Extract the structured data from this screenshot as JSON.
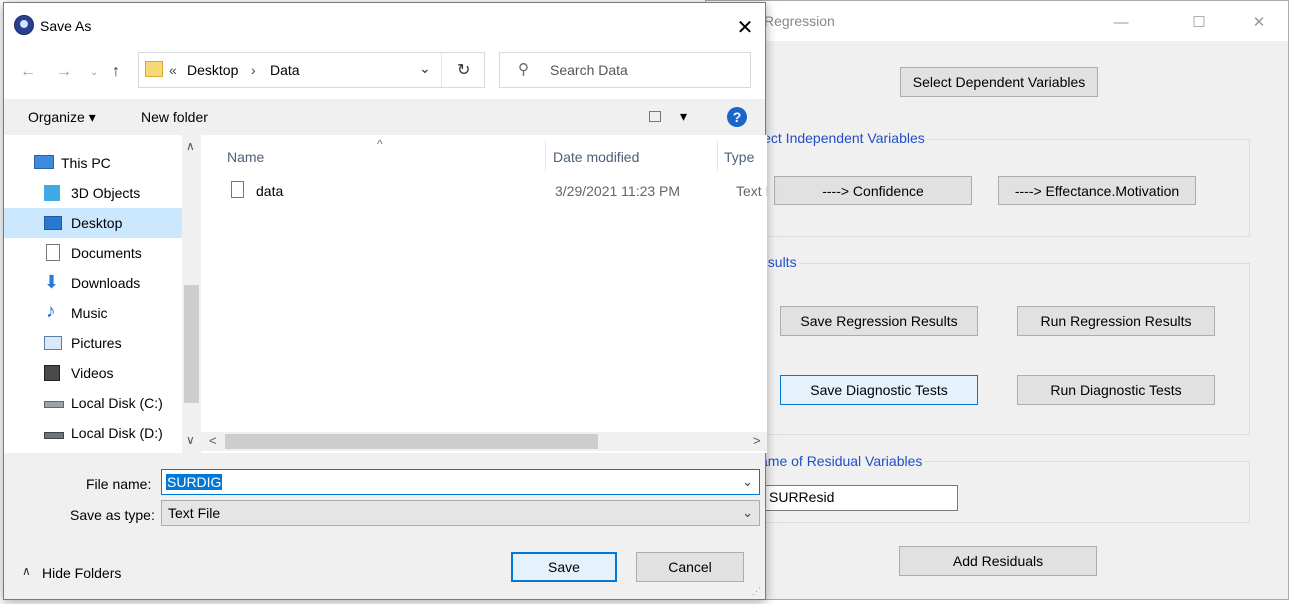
{
  "app_window": {
    "title": "R Regression",
    "title_visible": "Regression",
    "buttons": {
      "select_dependent": "Select Dependent Variables",
      "confidence": "----> Confidence",
      "effectance": "----> Effectance.Motivation",
      "save_regression": "Save Regression Results",
      "run_regression": "Run Regression Results",
      "save_diagnostic": "Save Diagnostic Tests",
      "run_diagnostic": "Run Diagnostic Tests",
      "add_residuals": "Add Residuals"
    },
    "groups": {
      "independent": "lect Independent Variables",
      "results": "esults",
      "residual_name": "ame of Residual Variables"
    },
    "residual_value": "SURResid",
    "caption": {
      "minimize": "—",
      "maximize": "☐",
      "close": "✕"
    }
  },
  "dialog": {
    "title": "Save As",
    "close": "✕",
    "breadcrumb": {
      "prefix": "«",
      "items": [
        "Desktop",
        "Data"
      ],
      "sep": "›"
    },
    "search_placeholder": "Search Data",
    "toolbar": {
      "organize": "Organize ▾",
      "new_folder": "New folder",
      "view": "▾",
      "help": "?"
    },
    "nav_items": [
      {
        "label": "This PC"
      },
      {
        "label": "3D Objects"
      },
      {
        "label": "Desktop"
      },
      {
        "label": "Documents"
      },
      {
        "label": "Downloads"
      },
      {
        "label": "Music"
      },
      {
        "label": "Pictures"
      },
      {
        "label": "Videos"
      },
      {
        "label": "Local Disk (C:)"
      },
      {
        "label": "Local Disk (D:)"
      }
    ],
    "columns": {
      "name": "Name",
      "date": "Date modified",
      "type": "Type"
    },
    "files": [
      {
        "name": "data",
        "date": "3/29/2021 11:23 PM",
        "type": "Text D"
      }
    ],
    "file_name_label": "File name:",
    "file_name_value": "SURDIG",
    "save_type_label": "Save as type:",
    "save_type_value": "Text File",
    "hide_folders": "Hide Folders",
    "save_button": "Save",
    "cancel_button": "Cancel"
  },
  "colors": {
    "accent": "#0078d7",
    "selection": "#cce8ff",
    "group_label": "#1f4fc8"
  }
}
